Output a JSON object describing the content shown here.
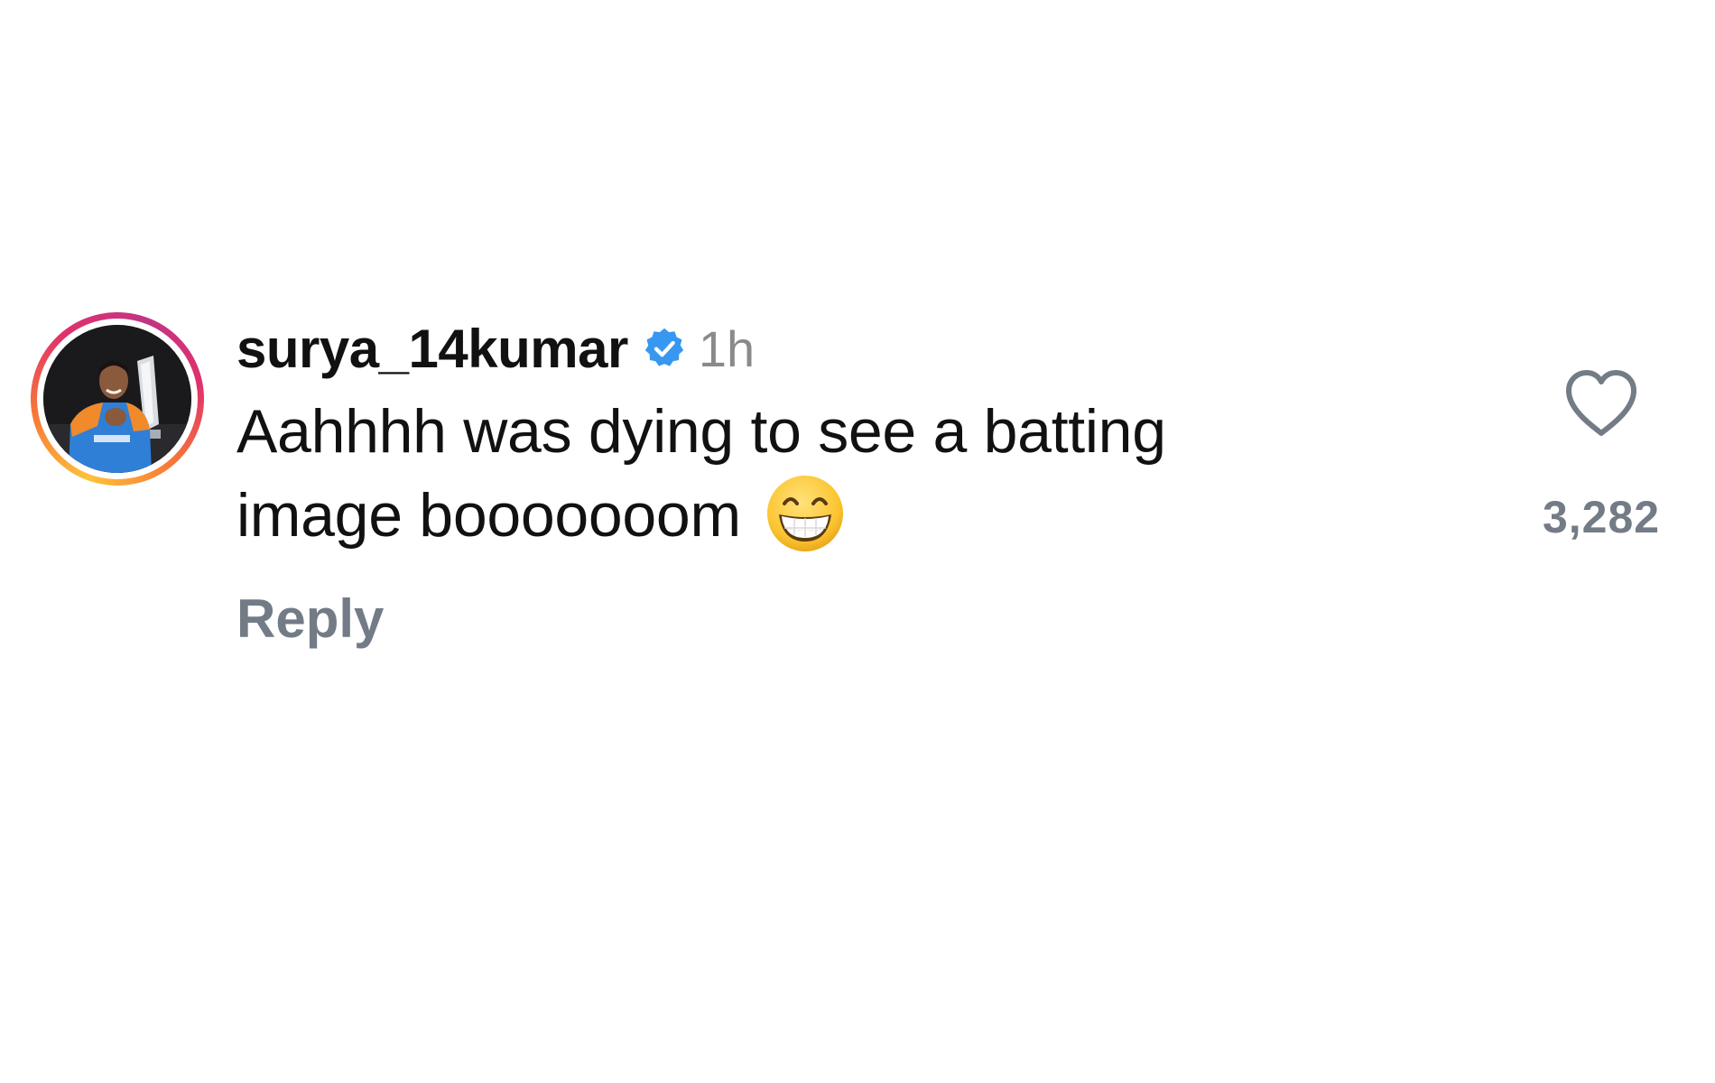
{
  "comment": {
    "username": "surya_14kumar",
    "timestamp": "1h",
    "text_line1": "Aahhhh was dying to see a batting",
    "text_line2": "image booooooom",
    "emoji": "grinning-face-with-smiling-eyes",
    "reply_label": "Reply",
    "like_count": "3,282",
    "verified": true,
    "colors": {
      "verified_badge": "#3897f0",
      "muted_text": "#737b86",
      "timestamp": "#8a8a8a",
      "primary_text": "#111111"
    }
  }
}
